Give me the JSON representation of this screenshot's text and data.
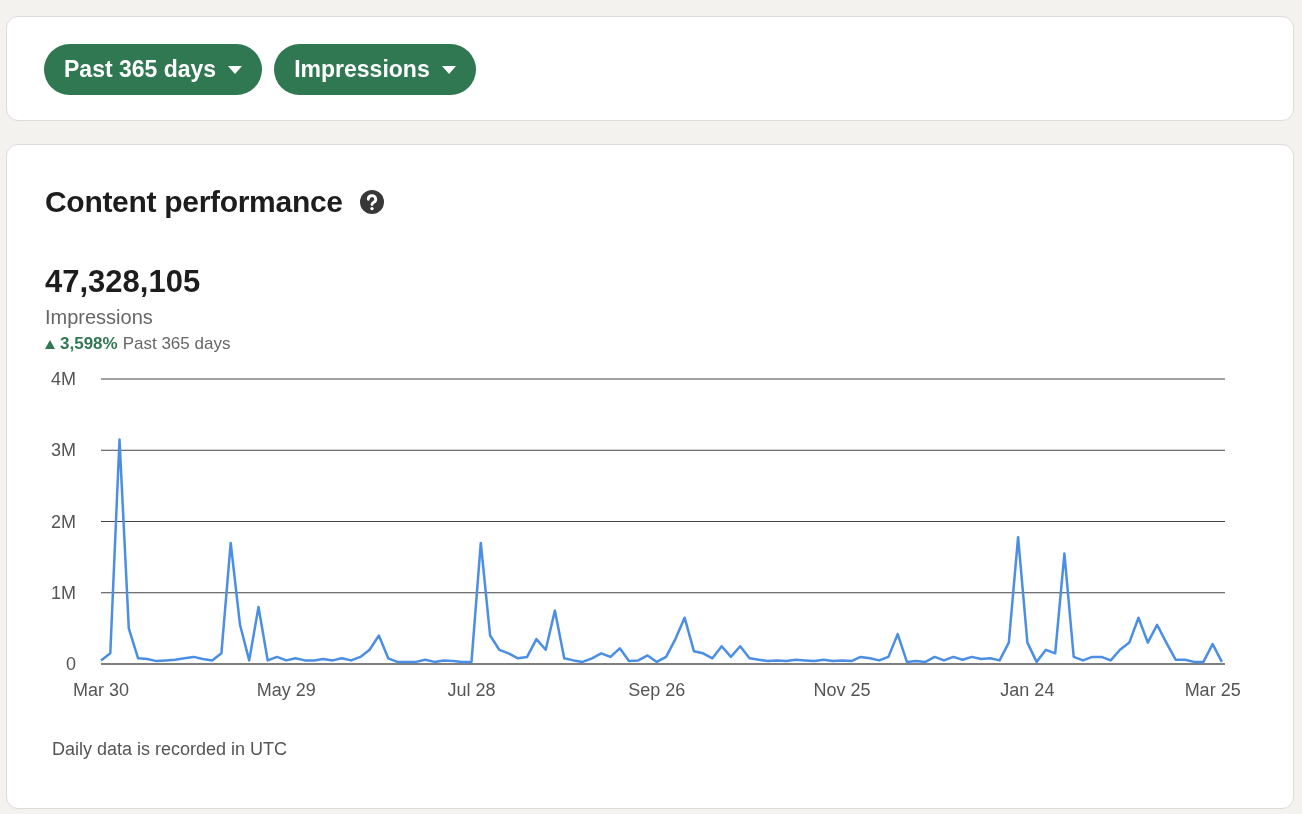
{
  "filters": [
    {
      "label": "Past 365 days"
    },
    {
      "label": "Impressions"
    }
  ],
  "panel": {
    "title": "Content performance",
    "total": "47,328,105",
    "metric": "Impressions",
    "change": {
      "increase": true,
      "value": "3,598%",
      "period": "Past 365 days"
    },
    "chart_data": {
      "type": "line",
      "grid": true,
      "ylim": [
        0,
        4
      ],
      "yticks": [
        {
          "value": 0,
          "label": "0"
        },
        {
          "value": 1,
          "label": "1M"
        },
        {
          "value": 2,
          "label": "2M"
        },
        {
          "value": 3,
          "label": "3M"
        },
        {
          "value": 4,
          "label": "4M"
        }
      ],
      "categories": [
        "Mar 30",
        null,
        null,
        null,
        null,
        null,
        null,
        null,
        null,
        null,
        null,
        null,
        null,
        null,
        null,
        null,
        null,
        null,
        null,
        null,
        "May 29",
        null,
        null,
        null,
        null,
        null,
        null,
        null,
        null,
        null,
        null,
        null,
        null,
        null,
        null,
        null,
        null,
        null,
        null,
        null,
        "Jul 28",
        null,
        null,
        null,
        null,
        null,
        null,
        null,
        null,
        null,
        null,
        null,
        null,
        null,
        null,
        null,
        null,
        null,
        null,
        null,
        "Sep 26",
        null,
        null,
        null,
        null,
        null,
        null,
        null,
        null,
        null,
        null,
        null,
        null,
        null,
        null,
        null,
        null,
        null,
        null,
        null,
        "Nov 25",
        null,
        null,
        null,
        null,
        null,
        null,
        null,
        null,
        null,
        null,
        null,
        null,
        null,
        null,
        null,
        null,
        null,
        null,
        null,
        "Jan 24",
        null,
        null,
        null,
        null,
        null,
        null,
        null,
        null,
        null,
        null,
        null,
        null,
        null,
        null,
        null,
        null,
        null,
        null,
        null,
        "Mar 25",
        null
      ],
      "series": [
        {
          "color": "#4a8ee6",
          "values": [
            0.05,
            0.15,
            3.15,
            0.5,
            0.08,
            0.07,
            0.04,
            0.05,
            0.06,
            0.08,
            0.1,
            0.07,
            0.05,
            0.15,
            1.7,
            0.55,
            0.05,
            0.8,
            0.05,
            0.1,
            0.05,
            0.08,
            0.05,
            0.05,
            0.07,
            0.05,
            0.08,
            0.05,
            0.1,
            0.2,
            0.4,
            0.08,
            0.03,
            0.03,
            0.03,
            0.06,
            0.03,
            0.05,
            0.04,
            0.03,
            0.03,
            1.7,
            0.4,
            0.2,
            0.15,
            0.08,
            0.1,
            0.35,
            0.2,
            0.75,
            0.08,
            0.05,
            0.03,
            0.08,
            0.15,
            0.1,
            0.22,
            0.04,
            0.05,
            0.12,
            0.03,
            0.1,
            0.35,
            0.65,
            0.18,
            0.15,
            0.08,
            0.25,
            0.1,
            0.25,
            0.08,
            0.06,
            0.04,
            0.05,
            0.04,
            0.06,
            0.05,
            0.04,
            0.06,
            0.04,
            0.05,
            0.04,
            0.1,
            0.08,
            0.05,
            0.1,
            0.42,
            0.03,
            0.04,
            0.03,
            0.1,
            0.05,
            0.1,
            0.06,
            0.1,
            0.07,
            0.08,
            0.05,
            0.3,
            1.78,
            0.3,
            0.03,
            0.2,
            0.15,
            1.55,
            0.1,
            0.05,
            0.1,
            0.1,
            0.05,
            0.2,
            0.3,
            0.65,
            0.3,
            0.55,
            0.3,
            0.06,
            0.06,
            0.03,
            0.03,
            0.28,
            0.03
          ]
        }
      ]
    },
    "note": "Daily data is recorded in UTC"
  }
}
